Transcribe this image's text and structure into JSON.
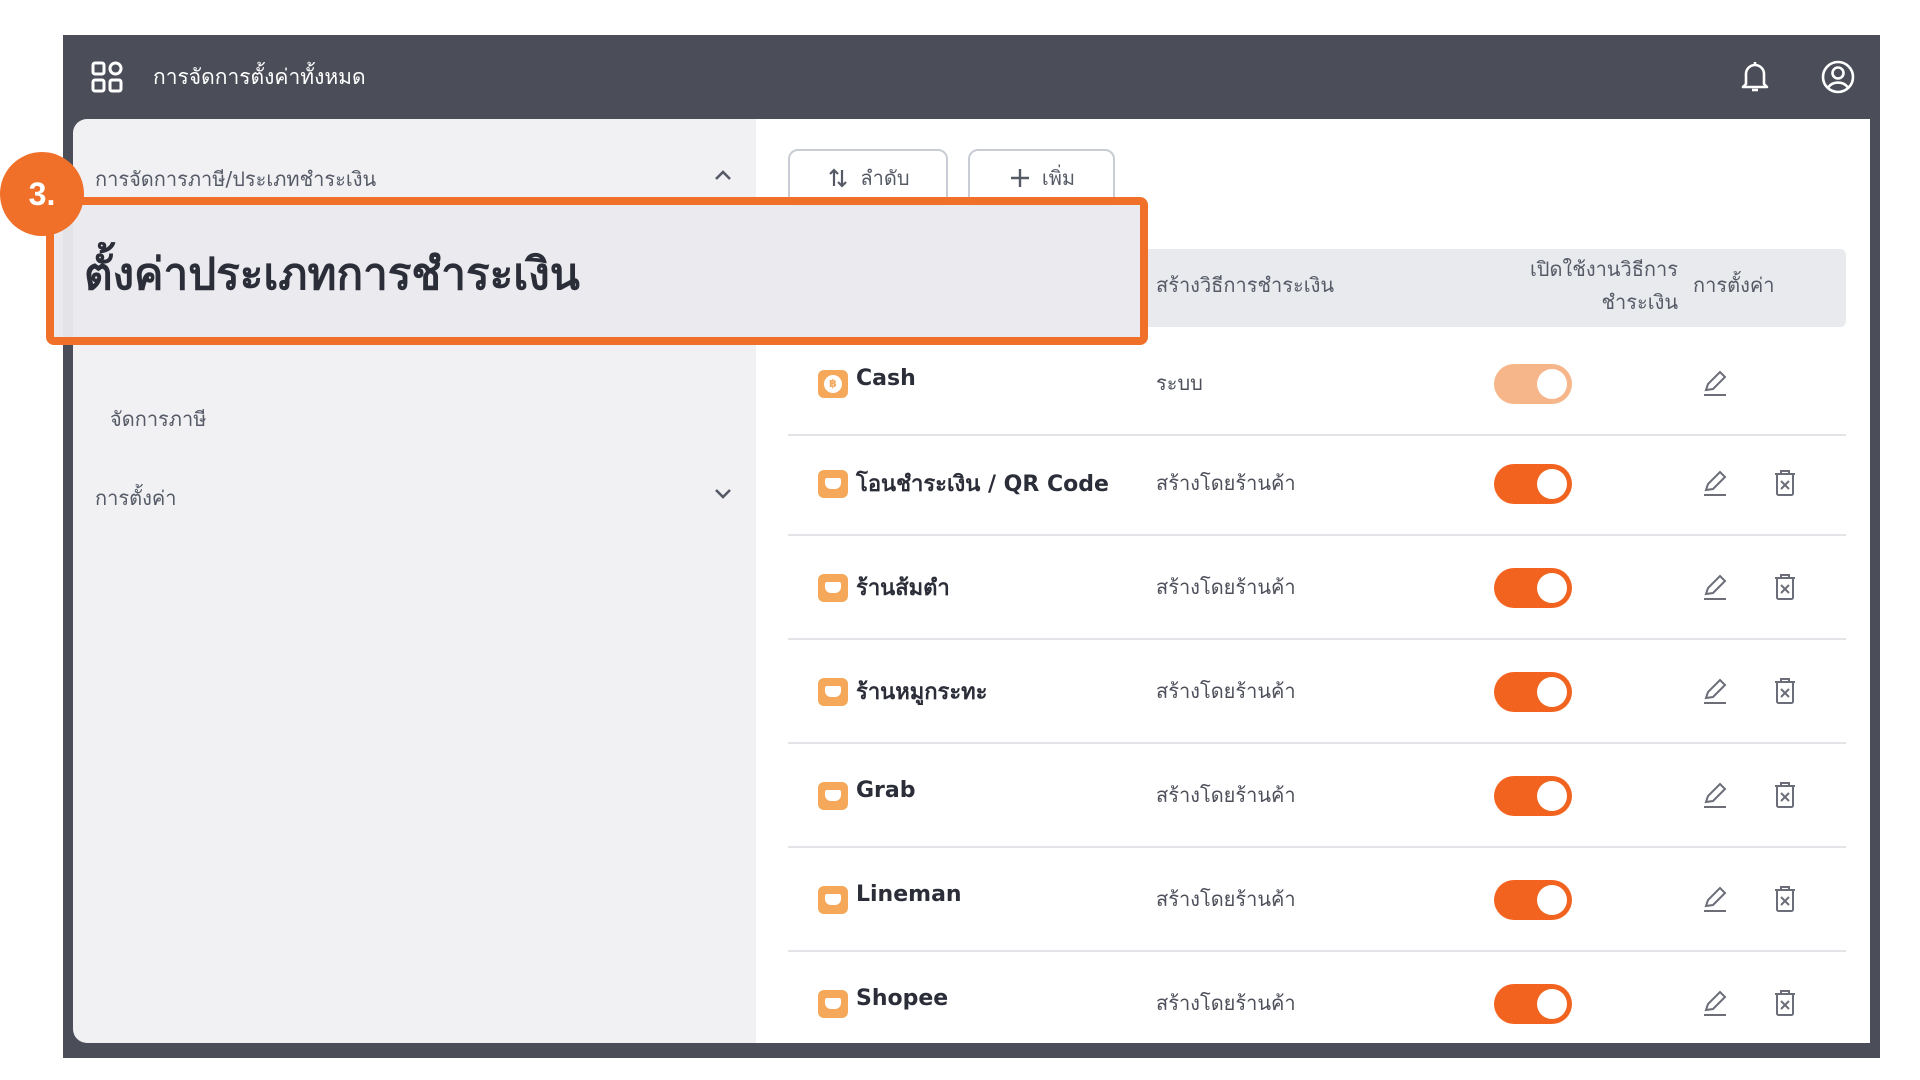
{
  "topbar": {
    "title": "การจัดการตั้งค่าทั้งหมด"
  },
  "sidebar": {
    "group_label": "การจัดการภาษี/ประเภทชำระเงิน",
    "sub_item": "จัดการภาษี",
    "settings_label": "การตั้งค่า"
  },
  "toolbar": {
    "order_label": "ลำดับ",
    "add_label": "เพิ่ม"
  },
  "table": {
    "headers": {
      "created_by": "สร้างวิธีการชำระเงิน",
      "enable_line1": "เปิดใช้งานวิธีการ",
      "enable_line2": "ชำระเงิน",
      "settings": "การตั้งค่า"
    },
    "rows": [
      {
        "name": "Cash",
        "creator": "ระบบ",
        "enabled": true,
        "deletable": false,
        "icon": "cash-icon"
      },
      {
        "name": "โอนชำระเงิน / QR Code",
        "creator": "สร้างโดยร้านค้า",
        "enabled": true,
        "deletable": true,
        "icon": "wallet-icon"
      },
      {
        "name": "ร้านส้มตำ",
        "creator": "สร้างโดยร้านค้า",
        "enabled": true,
        "deletable": true,
        "icon": "wallet-icon"
      },
      {
        "name": "ร้านหมูกระทะ",
        "creator": "สร้างโดยร้านค้า",
        "enabled": true,
        "deletable": true,
        "icon": "wallet-icon"
      },
      {
        "name": "Grab",
        "creator": "สร้างโดยร้านค้า",
        "enabled": true,
        "deletable": true,
        "icon": "wallet-icon"
      },
      {
        "name": "Lineman",
        "creator": "สร้างโดยร้านค้า",
        "enabled": true,
        "deletable": true,
        "icon": "wallet-icon"
      },
      {
        "name": "Shopee",
        "creator": "สร้างโดยร้านค้า",
        "enabled": true,
        "deletable": true,
        "icon": "wallet-icon"
      }
    ]
  },
  "annotation": {
    "step": "3.",
    "callout_text": "ตั้งค่าประเภทการชำระเงิน"
  },
  "colors": {
    "accent": "#f07029",
    "toggle_on": "#f2631f",
    "toggle_disabled": "#f6b68a",
    "topbar": "#4b4d59",
    "icon_orange": "#f5a85a"
  }
}
